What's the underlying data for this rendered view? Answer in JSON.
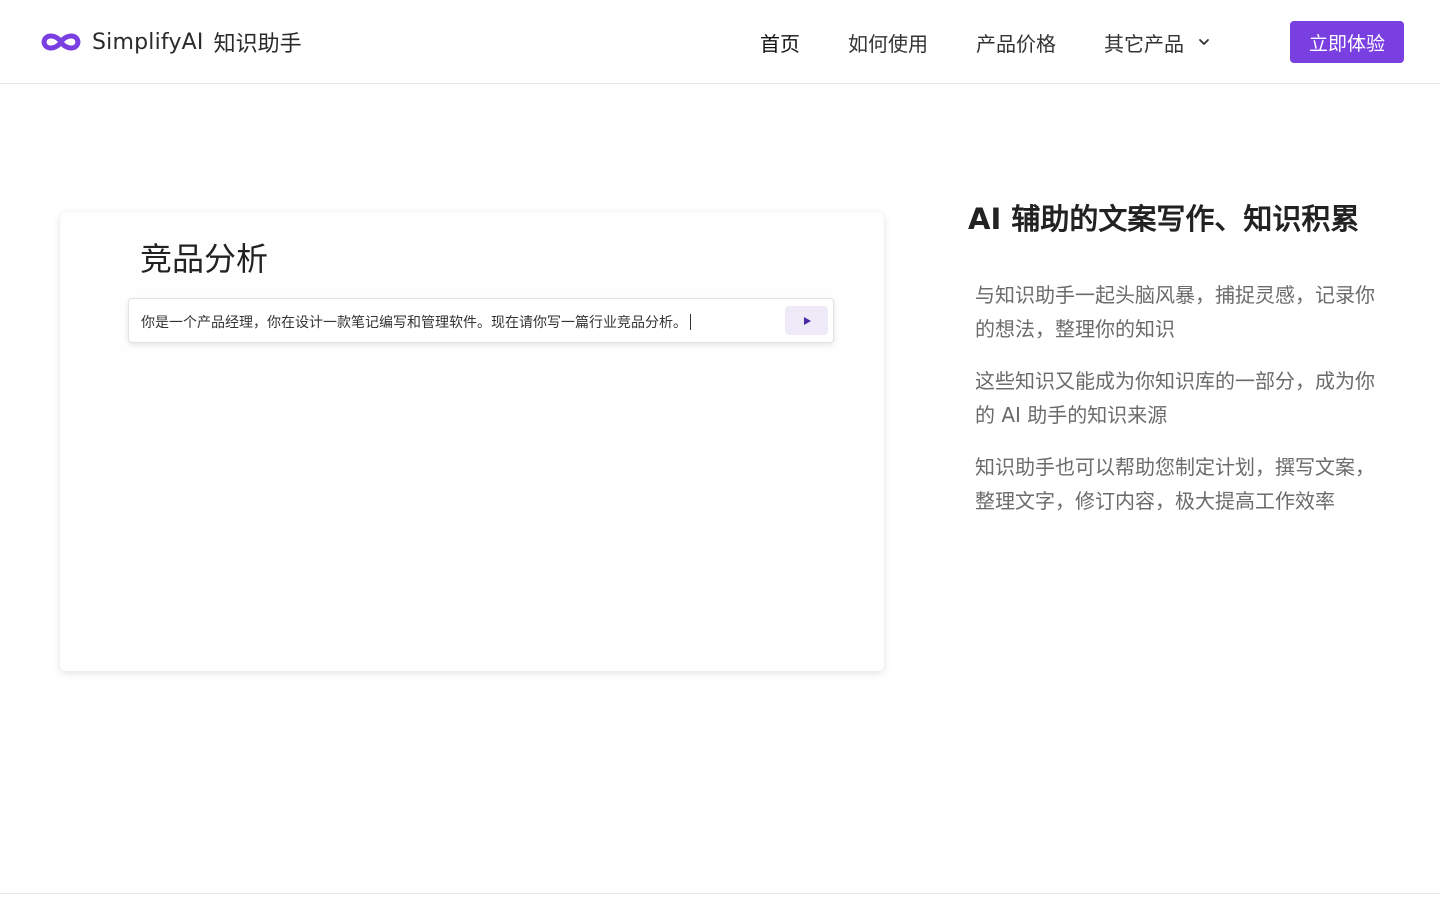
{
  "brand": {
    "name": "SimplifyAI",
    "product": "知识助手",
    "accent_color": "#7a3fe0",
    "logo_icon": "infinity-logo-icon"
  },
  "nav": {
    "items": [
      {
        "label": "首页",
        "active": true
      },
      {
        "label": "如何使用",
        "active": false
      },
      {
        "label": "产品价格",
        "active": false
      },
      {
        "label": "其它产品",
        "active": false,
        "has_dropdown": true
      }
    ],
    "cta_label": "立即体验"
  },
  "demo": {
    "title": "竞品分析",
    "input_text": "你是一个产品经理，你在设计一款笔记编写和管理软件。现在请你写一篇行业竞品分析。",
    "send_icon": "play-icon"
  },
  "feature": {
    "title": "AI 辅助的文案写作、知识积累",
    "paragraphs": [
      "与知识助手一起头脑风暴，捕捉灵感，记录你的想法，整理你的知识",
      "这些知识又能成为你知识库的一部分，成为你的 AI 助手的知识来源",
      "知识助手也可以帮助您制定计划，撰写文案，整理文字，修订内容，极大提高工作效率"
    ]
  }
}
